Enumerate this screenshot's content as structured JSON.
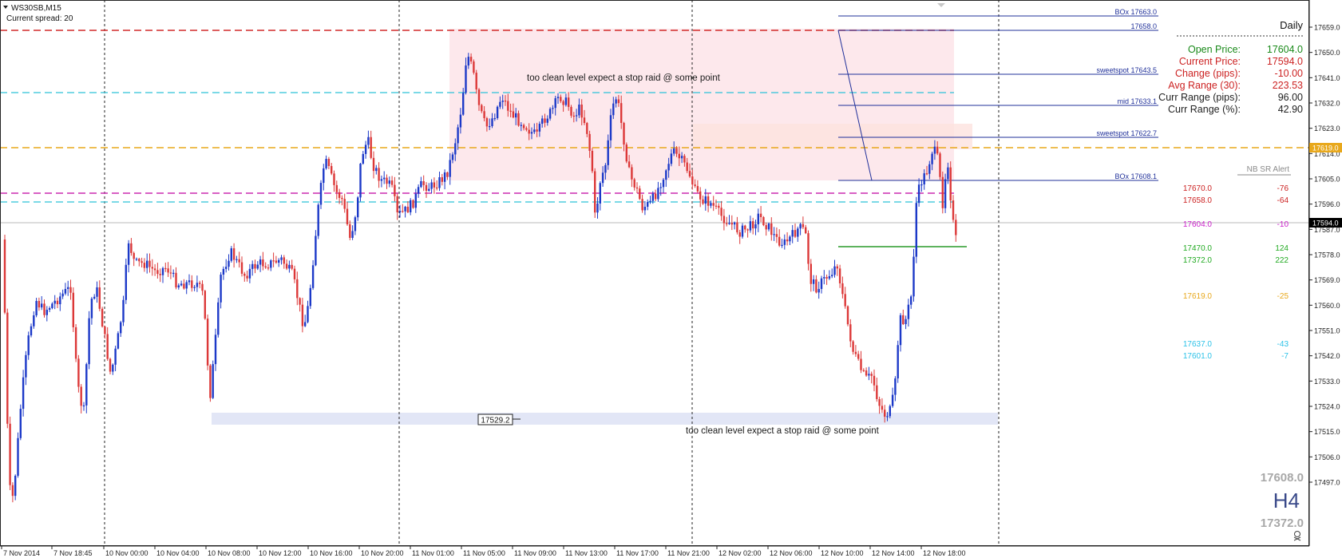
{
  "window": {
    "title": "WS30SB,M15",
    "spread_text": "Current spread: 20"
  },
  "colors": {
    "bull": "#1c39c8",
    "bear": "#dc3838",
    "zone_pink": "#fde8ec",
    "zone_orange": "#fde2de",
    "zone_blue": "#e2e6f6",
    "level_red": "#d22a2a",
    "level_cyan": "#2cc2d8",
    "level_orange": "#e8a81c",
    "level_magenta": "#cc2cb0",
    "fib_blue": "#20309a",
    "green": "#289a28"
  },
  "price_axis": {
    "min": 17488,
    "max": 17668,
    "ticks": [
      "17659.0",
      "17650.0",
      "17641.0",
      "17632.0",
      "17623.0",
      "17614.0",
      "17605.0",
      "17596.0",
      "17587.0",
      "17578.0",
      "17569.0",
      "17560.0",
      "17551.0",
      "17542.0",
      "17533.0",
      "17524.0",
      "17515.0",
      "17506.0",
      "17497.0"
    ],
    "current_price_label": "17594.0",
    "level_label": "17619.0"
  },
  "time_axis": {
    "labels": [
      "7 Nov 2014",
      "7 Nov 18:45",
      "10 Nov 00:00",
      "10 Nov 04:00",
      "10 Nov 08:00",
      "10 Nov 12:00",
      "10 Nov 16:00",
      "10 Nov 20:00",
      "11 Nov 01:00",
      "11 Nov 05:00",
      "11 Nov 09:00",
      "11 Nov 13:00",
      "11 Nov 17:00",
      "11 Nov 21:00",
      "12 Nov 02:00",
      "12 Nov 06:00",
      "12 Nov 10:00",
      "12 Nov 14:00",
      "12 Nov 18:00"
    ]
  },
  "daily_panel": {
    "title": "Daily",
    "rows": [
      {
        "label": "Open Price:",
        "value": "17604.0",
        "color": "#1a8a1a"
      },
      {
        "label": "Current Price:",
        "value": "17594.0",
        "color": "#cc2222"
      },
      {
        "label": "Change (pips):",
        "value": "-10.00",
        "color": "#cc2222"
      },
      {
        "label": "Avg Range (30):",
        "value": "223.53",
        "color": "#cc2222"
      },
      {
        "label": "Curr Range (pips):",
        "value": "96.00",
        "color": "#222222"
      },
      {
        "label": "Curr Range (%):",
        "value": "42.90",
        "color": "#222222"
      }
    ]
  },
  "sr_alert": {
    "title": "NB SR Alert",
    "rows": [
      {
        "level": "17670.0",
        "diff": "-76",
        "color": "#cc2222"
      },
      {
        "level": "17658.0",
        "diff": "-64",
        "color": "#cc2222"
      },
      {
        "level": "17604.0",
        "diff": "-10",
        "color": "#cc22cc"
      },
      {
        "level": "17470.0",
        "diff": "124",
        "color": "#22aa22"
      },
      {
        "level": "17372.0",
        "diff": "222",
        "color": "#22aa22"
      },
      {
        "level": "17619.0",
        "diff": "-25",
        "color": "#e8a81c"
      },
      {
        "level": "17637.0",
        "diff": "-43",
        "color": "#2cc2e8"
      },
      {
        "level": "17601.0",
        "diff": "-7",
        "color": "#2cc2e8"
      }
    ]
  },
  "fib_labels": [
    "BOx  17663.0",
    "17658.0",
    "sweetspot  17643.5",
    "mid  17633.1",
    "sweetspot  17622.7",
    "BOx  17608.1"
  ],
  "annotations": {
    "top_note": "too clean level expect a stop raid @ some point",
    "bottom_note": "too clean level expect a stop raid @ some point",
    "low_marker": "17529.2"
  },
  "h4_badge": {
    "high": "17608.0",
    "tf": "H4",
    "low": "17372.0"
  }
}
